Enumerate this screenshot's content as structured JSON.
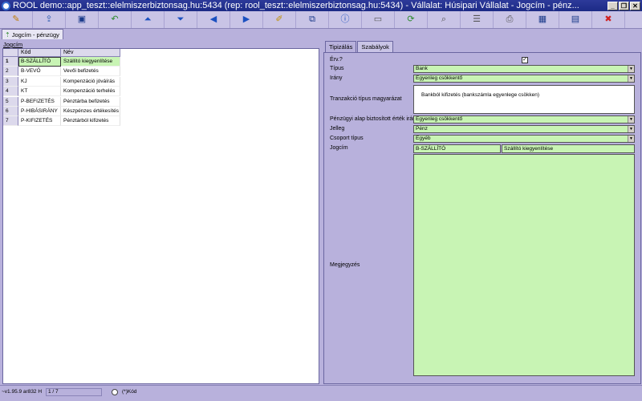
{
  "window": {
    "title": "ROOL demo::app_teszt::elelmiszerbiztonsag.hu:5434 (rep: rool_teszt::elelmiszerbiztonsag.hu:5434) - Vállalat: Húsipari Vállalat - Jogcím - pénz...",
    "minimize": "_",
    "restore": "❐",
    "close": "✕"
  },
  "toolbar": [
    {
      "icon": "edit-icon",
      "glyph": "✎",
      "color": "#c07a00"
    },
    {
      "icon": "export-icon",
      "glyph": "⇪",
      "color": "#2a5ab0"
    },
    {
      "icon": "save-icon",
      "glyph": "▣",
      "color": "#1a3a8a"
    },
    {
      "icon": "undo-icon",
      "glyph": "↶",
      "color": "#2d8a2d"
    },
    {
      "icon": "first-record-icon",
      "glyph": "⏶",
      "color": "#1a50c0"
    },
    {
      "icon": "last-record-icon",
      "glyph": "⏷",
      "color": "#1a50c0"
    },
    {
      "icon": "previous-icon",
      "glyph": "◀",
      "color": "#1a50c0"
    },
    {
      "icon": "next-icon",
      "glyph": "▶",
      "color": "#1a50c0"
    },
    {
      "icon": "note-icon",
      "glyph": "✐",
      "color": "#c09000"
    },
    {
      "icon": "copy-icon",
      "glyph": "⧉",
      "color": "#1a3a8a"
    },
    {
      "icon": "info-icon",
      "glyph": "ⓘ",
      "color": "#1a50c0"
    },
    {
      "icon": "window-icon",
      "glyph": "▭",
      "color": "#555555"
    },
    {
      "icon": "refresh-icon",
      "glyph": "⟳",
      "color": "#2d8a2d"
    },
    {
      "icon": "search-icon",
      "glyph": "⌕",
      "color": "#555555"
    },
    {
      "icon": "layout-icon",
      "glyph": "☰",
      "color": "#555555"
    },
    {
      "icon": "print-icon",
      "glyph": "⎙",
      "color": "#555555"
    },
    {
      "icon": "table-icon",
      "glyph": "▦",
      "color": "#1a3a8a"
    },
    {
      "icon": "form-icon",
      "glyph": "▤",
      "color": "#1a3a8a"
    },
    {
      "icon": "exit-icon",
      "glyph": "✖",
      "color": "#d02020"
    }
  ],
  "doc_tab": "Jogcím - pénzügy",
  "list": {
    "heading": "Jogcím",
    "columns": {
      "kod": "Kód",
      "nev": "Név"
    },
    "rows": [
      {
        "n": "1",
        "kod": "B-SZÁLLÍTÓ",
        "nev": "Szállító kiegyenlítése",
        "selected": true
      },
      {
        "n": "2",
        "kod": "B-VEVŐ",
        "nev": "Vevői befizetés"
      },
      {
        "n": "3",
        "kod": "KJ",
        "nev": "Kompenzáció jóváírás"
      },
      {
        "n": "4",
        "kod": "KT",
        "nev": "Kompenzáció terhelés"
      },
      {
        "n": "5",
        "kod": "P-BEFIZETÉS",
        "nev": "Pénztárba befizetés"
      },
      {
        "n": "6",
        "kod": "P-HIBÁSIRÁNY",
        "nev": "Készpénzes értékesítés"
      },
      {
        "n": "7",
        "kod": "P-KIFIZETÉS",
        "nev": "Pénztárból kifizetés"
      }
    ]
  },
  "detail": {
    "tabs": [
      "Tipizálás",
      "Szabályok"
    ],
    "labels": {
      "erv": "Érv.?",
      "tipus": "Típus",
      "irany": "Irány",
      "tranzakcio": "Tranzakció típus magyarázat",
      "penzugyi": "Pénzügyi alap biztosított érték irány",
      "jelleg": "Jelleg",
      "csoport": "Csoport típus",
      "jogcim": "Jogcím",
      "megjegyzes": "Megjegyzés"
    },
    "values": {
      "erv_checked": "✓",
      "tipus": "Bank",
      "irany": "Egyenleg csökkentő",
      "tranzakcio": "Bankból kifizetés (bankszámla egyenlege csökken)",
      "penzugyi": "Egyenleg csökkentő",
      "jelleg": "Pénz",
      "csoport": "Egyéb",
      "jogcim_kod": "B-SZÁLLÍTÓ",
      "jogcim_nev": "Szállító kiegyenlítése",
      "dropdown_glyph": "▼"
    }
  },
  "status": {
    "version": "~v1.95.9 ar832 H",
    "record": "1 / 7",
    "sort": "(*)Kód"
  }
}
